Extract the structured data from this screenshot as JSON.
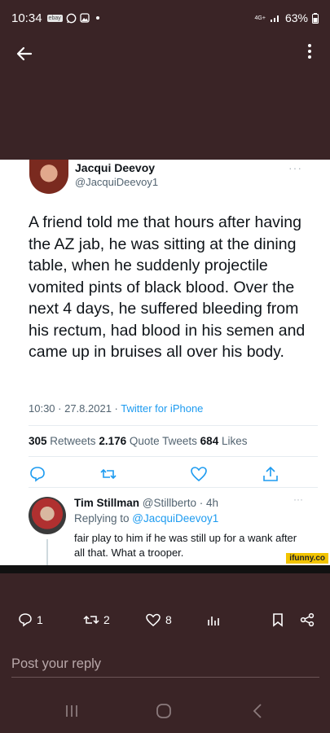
{
  "statusbar": {
    "time": "10:34",
    "ebay": "ebay",
    "network": "4G+",
    "battery": "63%"
  },
  "tweet": {
    "name": "Jacqui Deevoy",
    "handle": "@JacquiDeevoy1",
    "more": "···",
    "text": "A friend told me that hours after having the AZ jab, he was sitting at the dining table, when he suddenly projectile vomited pints of black blood. Over the next 4 days, he suffered bleeding from his rectum, had blood in his semen and came up in bruises all over his body.",
    "time": "10:30 · 27.8.2021 · ",
    "source": "Twitter for iPhone",
    "retweets_count": "305",
    "retweets_label": " Retweets  ",
    "quotes_count": "2.176",
    "quotes_label": " Quote Tweets  ",
    "likes_count": "684",
    "likes_label": " Likes"
  },
  "reply": {
    "name": "Tim Stillman",
    "handle_time": " @Stillberto · 4h",
    "replying_prefix": "Replying to ",
    "replying_to": "@JacquiDeevoy1",
    "text": "fair play to him if he was still up for a wank after all that. What a trooper.",
    "more": "···"
  },
  "watermark": "ifunny.co",
  "engagement": {
    "replies": "1",
    "reposts": "2",
    "likes": "8"
  },
  "reply_input": {
    "placeholder": "Post your reply"
  }
}
